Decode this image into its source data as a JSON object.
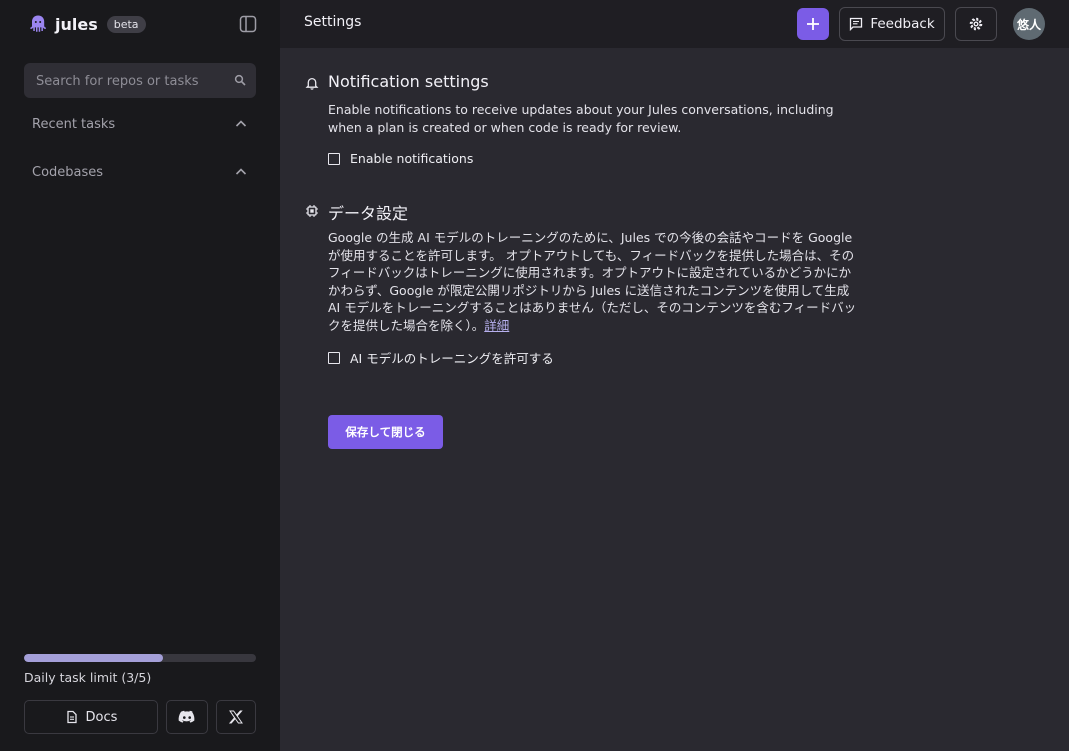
{
  "sidebar": {
    "brand_name": "jules",
    "beta_badge": "beta",
    "search_placeholder": "Search for repos or tasks",
    "recent_tasks_label": "Recent tasks",
    "codebases_label": "Codebases",
    "task_limit_label": "Daily task limit (3/5)",
    "task_limit_used": 3,
    "task_limit_total": 5,
    "docs_label": "Docs"
  },
  "header": {
    "title": "Settings",
    "feedback_label": "Feedback",
    "avatar_text": "悠人"
  },
  "notification": {
    "title": "Notification settings",
    "description": "Enable notifications to receive updates about your Jules conversations, including when a plan is created or when code is ready for review.",
    "checkbox_label": "Enable notifications",
    "checked": false
  },
  "data_settings": {
    "title": "データ設定",
    "description": "Google の生成 AI モデルのトレーニングのために、Jules での今後の会話やコードを Google が使用することを許可します。 オプトアウトしても、フィードバックを提供した場合は、そのフィードバックはトレーニングに使用されます。オプトアウトに設定されているかどうかにかかわらず、Google が限定公開リポジトリから Jules に送信されたコンテンツを使用して生成 AI モデルをトレーニングすることはありません（ただし、そのコンテンツを含むフィードバックを提供した場合を除く）。",
    "details_link": "詳細",
    "checkbox_label": "AI モデルのトレーニングを許可する",
    "checked": false
  },
  "save_button_label": "保存して閉じる",
  "colors": {
    "accent": "#7b5ce6",
    "sidebar_bg": "#19191c",
    "main_bg": "#2a2930",
    "progress_fill": "#a49fd8"
  }
}
